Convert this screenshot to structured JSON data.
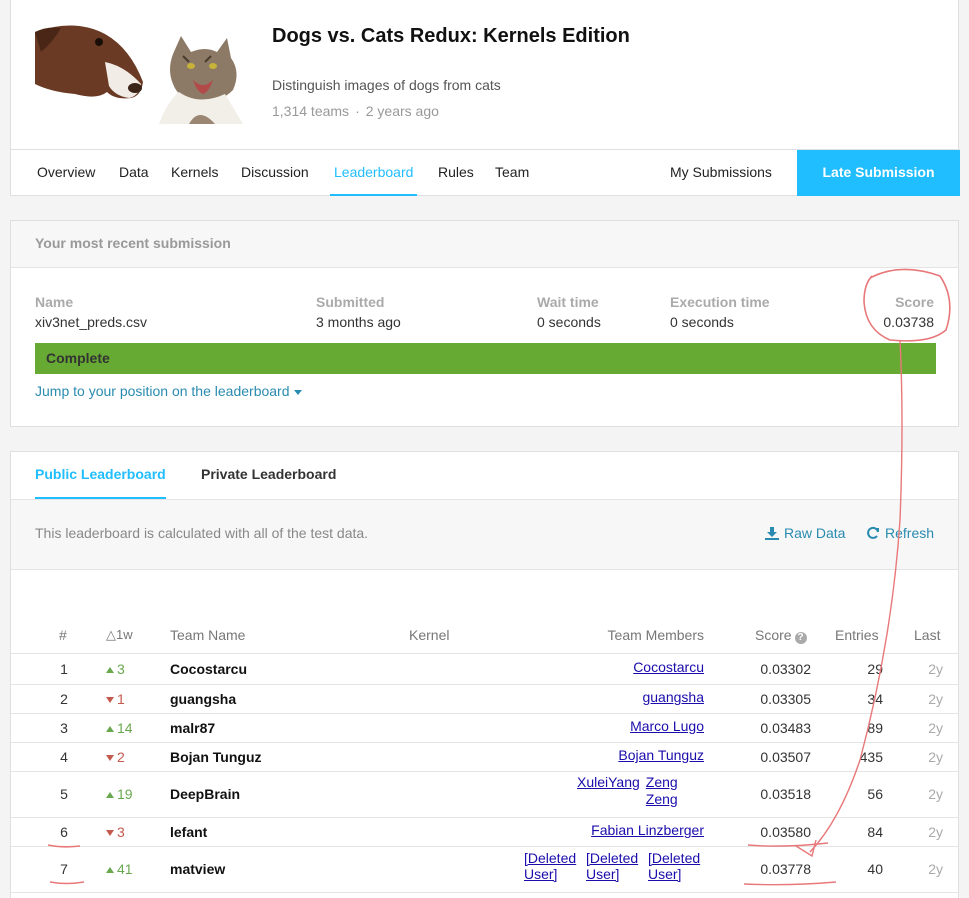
{
  "competition": {
    "title": "Dogs vs. Cats Redux: Kernels Edition",
    "subtitle": "Distinguish images of dogs from cats",
    "teams": "1,314 teams",
    "separator": "·",
    "age": "2 years ago"
  },
  "nav": {
    "tabs": [
      "Overview",
      "Data",
      "Kernels",
      "Discussion",
      "Leaderboard",
      "Rules",
      "Team"
    ],
    "active": "Leaderboard",
    "my_submissions": "My Submissions",
    "late_submission": "Late Submission"
  },
  "submission": {
    "heading": "Your most recent submission",
    "name_label": "Name",
    "name_value": "xiv3net_preds.csv",
    "submitted_label": "Submitted",
    "submitted_value": "3 months ago",
    "wait_label": "Wait time",
    "wait_value": "0 seconds",
    "exec_label": "Execution time",
    "exec_value": "0 seconds",
    "score_label": "Score",
    "score_value": "0.03738",
    "status": "Complete",
    "status_color": "#66aa33",
    "jump_link": "Jump to your position on the leaderboard"
  },
  "leaderboard": {
    "tabs": [
      "Public Leaderboard",
      "Private Leaderboard"
    ],
    "info": "This leaderboard is calculated with all of the test data.",
    "raw_data": "Raw Data",
    "refresh": "Refresh",
    "headers": {
      "rank": "#",
      "delta": "△1w",
      "team": "Team Name",
      "kernel": "Kernel",
      "members": "Team Members",
      "score": "Score",
      "entries": "Entries",
      "last": "Last"
    },
    "rows": [
      {
        "rank": "1",
        "dir": "up",
        "delta": "3",
        "team": "Cocostarcu",
        "members": [
          "Cocostarcu"
        ],
        "score": "0.03302",
        "entries": "29",
        "last": "2y"
      },
      {
        "rank": "2",
        "dir": "down",
        "delta": "1",
        "team": "guangsha",
        "members": [
          "guangsha"
        ],
        "score": "0.03305",
        "entries": "34",
        "last": "2y"
      },
      {
        "rank": "3",
        "dir": "up",
        "delta": "14",
        "team": "malr87",
        "members": [
          "Marco Lugo"
        ],
        "score": "0.03483",
        "entries": "89",
        "last": "2y"
      },
      {
        "rank": "4",
        "dir": "down",
        "delta": "2",
        "team": "Bojan Tunguz",
        "members": [
          "Bojan Tunguz"
        ],
        "score": "0.03507",
        "entries": "435",
        "last": "2y"
      },
      {
        "rank": "5",
        "dir": "up",
        "delta": "19",
        "team": "DeepBrain",
        "members": [
          "XuleiYang",
          "Zeng Zeng"
        ],
        "score": "0.03518",
        "entries": "56",
        "last": "2y"
      },
      {
        "rank": "6",
        "dir": "down",
        "delta": "3",
        "team": "lefant",
        "members": [
          "Fabian Linzberger"
        ],
        "score": "0.03580",
        "entries": "84",
        "last": "2y"
      },
      {
        "rank": "7",
        "dir": "up",
        "delta": "41",
        "team": "matview",
        "members": [
          "[Deleted User]",
          "[Deleted User]",
          "[Deleted User]"
        ],
        "score": "0.03778",
        "entries": "40",
        "last": "2y"
      }
    ]
  },
  "colors": {
    "accent": "#20beff",
    "link": "#2a8bb0",
    "up": "#6aa84f",
    "down": "#c4594d",
    "annotation": "#e8787a"
  }
}
